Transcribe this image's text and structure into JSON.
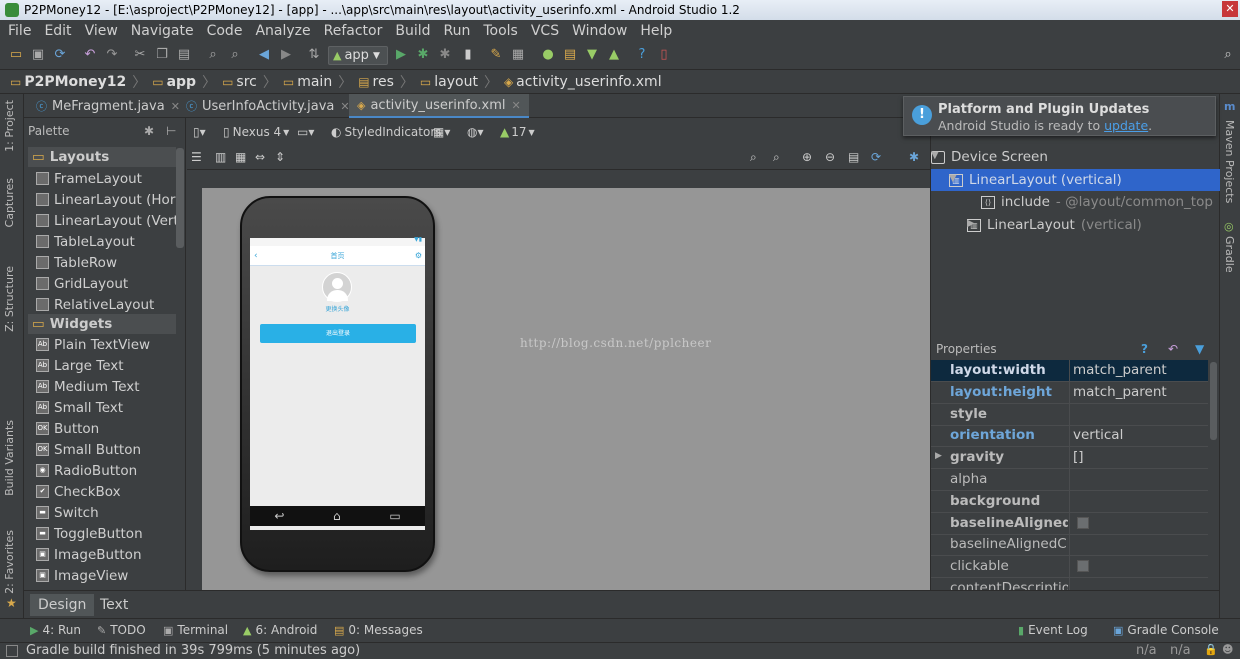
{
  "title": "P2PMoney12 - [E:\\asproject\\P2PMoney12] - [app] - ...\\app\\src\\main\\res\\layout\\activity_userinfo.xml - Android Studio 1.2",
  "menu": [
    "File",
    "Edit",
    "View",
    "Navigate",
    "Code",
    "Analyze",
    "Refactor",
    "Build",
    "Run",
    "Tools",
    "VCS",
    "Window",
    "Help"
  ],
  "toolbar": {
    "run_config": "app"
  },
  "breadcrumb": [
    "P2PMoney12",
    "app",
    "src",
    "main",
    "res",
    "layout",
    "activity_userinfo.xml"
  ],
  "left_tools": [
    "1: Project",
    "Captures",
    "Z: Structure",
    "Build Variants",
    "2: Favorites"
  ],
  "right_tools": [
    "Maven Projects",
    "Gradle"
  ],
  "editor_tabs": [
    {
      "label": "MeFragment.java",
      "icon": "C"
    },
    {
      "label": "UserInfoActivity.java",
      "icon": "C"
    },
    {
      "label": "activity_userinfo.xml",
      "icon": "xml"
    }
  ],
  "palette": {
    "title": "Palette",
    "categories": {
      "layouts": "Layouts",
      "widgets": "Widgets"
    },
    "layouts": [
      "FrameLayout",
      "LinearLayout (Horizontal)",
      "LinearLayout (Vertical)",
      "TableLayout",
      "TableRow",
      "GridLayout",
      "RelativeLayout"
    ],
    "widgets": [
      "Plain TextView",
      "Large Text",
      "Medium Text",
      "Small Text",
      "Button",
      "Small Button",
      "RadioButton",
      "CheckBox",
      "Switch",
      "ToggleButton",
      "ImageButton",
      "ImageView"
    ],
    "widget_icons": [
      "Ab",
      "Ab",
      "Ab",
      "Ab",
      "OK",
      "OK",
      "◉",
      "✔",
      "▬",
      "▬",
      "▣",
      "▣"
    ]
  },
  "designer": {
    "device": "Nexus 4",
    "theme": "StyledIndicators",
    "api": "17",
    "phone": {
      "header_title": "首页",
      "avatar_label": "更换头像",
      "logout_button": "退出登录"
    },
    "watermark": "http://blog.csdn.net/pplcheer"
  },
  "notification": {
    "title": "Platform and Plugin Updates",
    "text": "Android Studio is ready to ",
    "link": "update",
    "tail": "."
  },
  "component_tree": {
    "root": "Device Screen",
    "items": [
      {
        "name": "LinearLayout",
        "detail": "(vertical)"
      },
      {
        "name": "include",
        "detail": "- @layout/common_top"
      },
      {
        "name": "LinearLayout",
        "detail": "(vertical)"
      }
    ]
  },
  "properties": {
    "title": "Properties",
    "rows": [
      {
        "name": "layout:width",
        "value": "match_parent"
      },
      {
        "name": "layout:height",
        "value": "match_parent"
      },
      {
        "name": "style",
        "value": ""
      },
      {
        "name": "orientation",
        "value": "vertical"
      },
      {
        "name": "gravity",
        "value": "[]"
      },
      {
        "name": "alpha",
        "value": ""
      },
      {
        "name": "background",
        "value": ""
      },
      {
        "name": "baselineAligned",
        "value": ""
      },
      {
        "name": "baselineAlignedChildIndex",
        "value": ""
      },
      {
        "name": "clickable",
        "value": ""
      },
      {
        "name": "contentDescription",
        "value": ""
      }
    ]
  },
  "bottom_tabs": [
    "Design",
    "Text"
  ],
  "tool_windows": {
    "run": "4: Run",
    "todo": "TODO",
    "terminal": "Terminal",
    "android": "6: Android",
    "messages": "0: Messages",
    "event_log": "Event Log",
    "gradle_console": "Gradle Console"
  },
  "status": {
    "message": "Gradle build finished in 39s 799ms (5 minutes ago)",
    "pos1": "n/a",
    "pos2": "n/a"
  }
}
